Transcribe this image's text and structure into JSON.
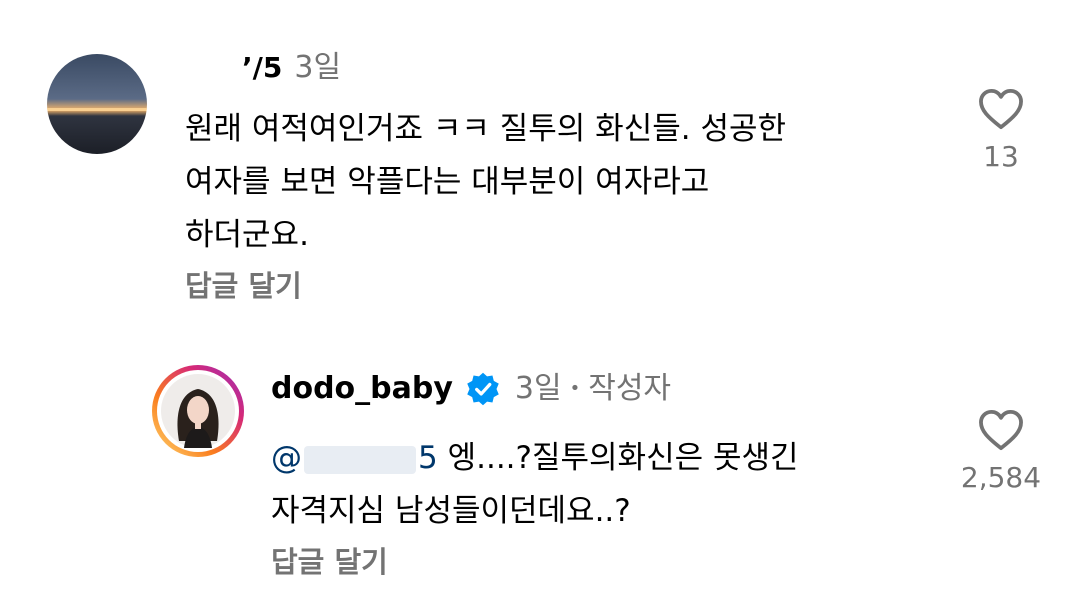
{
  "comments": [
    {
      "username": "’/5",
      "time": "3일",
      "text_lines": [
        "원래 여적여인거죠 ㅋㅋ 질투의 화신들. 성공한",
        "여자를 보면 악플다는 대부분이 여자라고",
        "하더군요."
      ],
      "reply_label": "답글 달기",
      "likes": "13"
    },
    {
      "username": "dodo_baby",
      "time": "3일",
      "separator": "•",
      "author_label": "작성자",
      "mention": "@",
      "mention_tail": "5",
      "text_line1_rest": " 엥....?질투의화신은 못생긴",
      "text_line2": "자격지심 남성들이던데요..?",
      "reply_label": "답글 달기",
      "likes": "2,584"
    }
  ],
  "colors": {
    "meta": "#737373",
    "verified": "#0095f6",
    "mention": "#00376b",
    "story_ring": [
      "#feda75",
      "#fa7e1e",
      "#d62976",
      "#962fbf"
    ]
  },
  "icons": [
    "heart-outline-icon",
    "verified-badge-icon"
  ]
}
